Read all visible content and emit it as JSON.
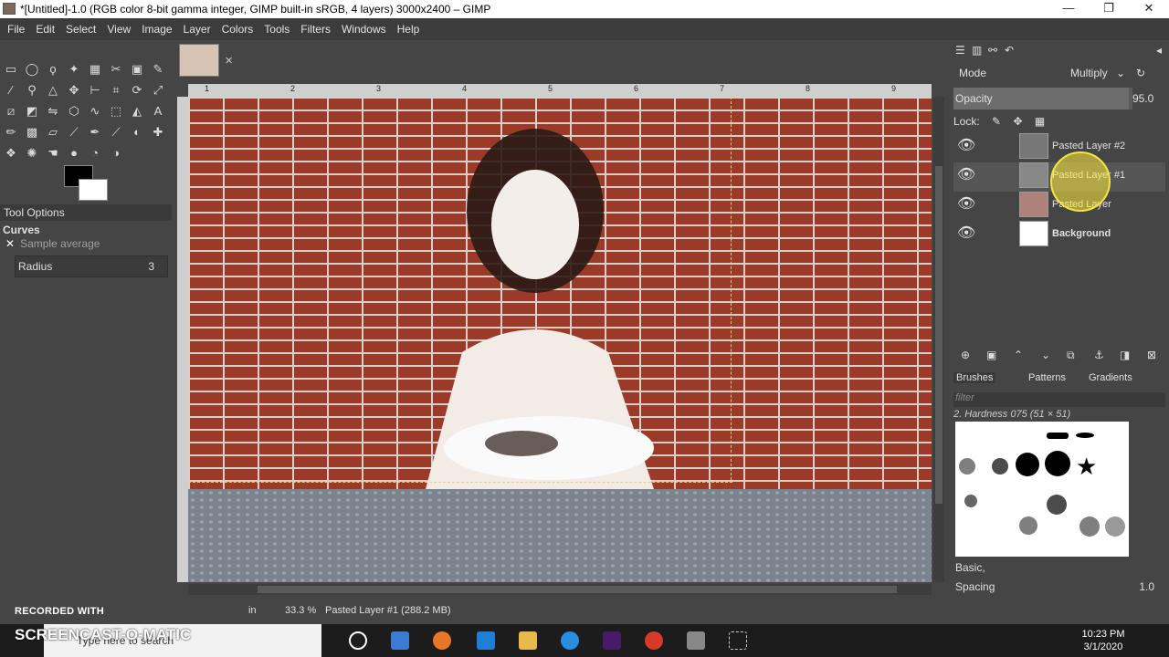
{
  "window": {
    "title": "*[Untitled]-1.0 (RGB color 8-bit gamma integer, GIMP built-in sRGB, 4 layers) 3000x2400 – GIMP",
    "min": "—",
    "max": "❐",
    "close": "✕"
  },
  "menu": [
    "File",
    "Edit",
    "Select",
    "View",
    "Image",
    "Layer",
    "Colors",
    "Tools",
    "Filters",
    "Windows",
    "Help"
  ],
  "image_tab_close": "✕",
  "tool_options": {
    "header": "Tool Options",
    "tool": "Curves",
    "sample_average_label": "Sample average",
    "sample_check": "✕",
    "radius_label": "Radius",
    "radius_value": "3"
  },
  "ruler": [
    "1",
    "2",
    "3",
    "4",
    "5",
    "6",
    "7",
    "8",
    "9"
  ],
  "status": {
    "unit": "in",
    "zoom": "33.3 %",
    "info": "Pasted Layer #1 (288.2 MB)"
  },
  "layers_panel": {
    "mode_label": "Mode",
    "mode_value": "Multiply",
    "opacity_label": "Opacity",
    "opacity_value": "95.0",
    "lock_label": "Lock:",
    "layers": [
      {
        "name": "Pasted Layer #2"
      },
      {
        "name": "Pasted Layer #1"
      },
      {
        "name": "Pasted Layer"
      },
      {
        "name": "Background"
      }
    ]
  },
  "brushes_panel": {
    "tab_brushes": "Brushes",
    "tab_patterns": "Patterns",
    "tab_gradients": "Gradients",
    "filter_placeholder": "filter",
    "brush_name": "2. Hardness 075 (51 × 51)",
    "preset": "Basic,",
    "spacing_label": "Spacing",
    "spacing_value": "1.0"
  },
  "overlay": {
    "recorded_with": "RECORDED WITH",
    "screencast": "SCREENCAST-O-MATIC"
  },
  "taskbar": {
    "search_placeholder": "Type here to search",
    "time": "10:23 PM",
    "date": "3/1/2020"
  }
}
